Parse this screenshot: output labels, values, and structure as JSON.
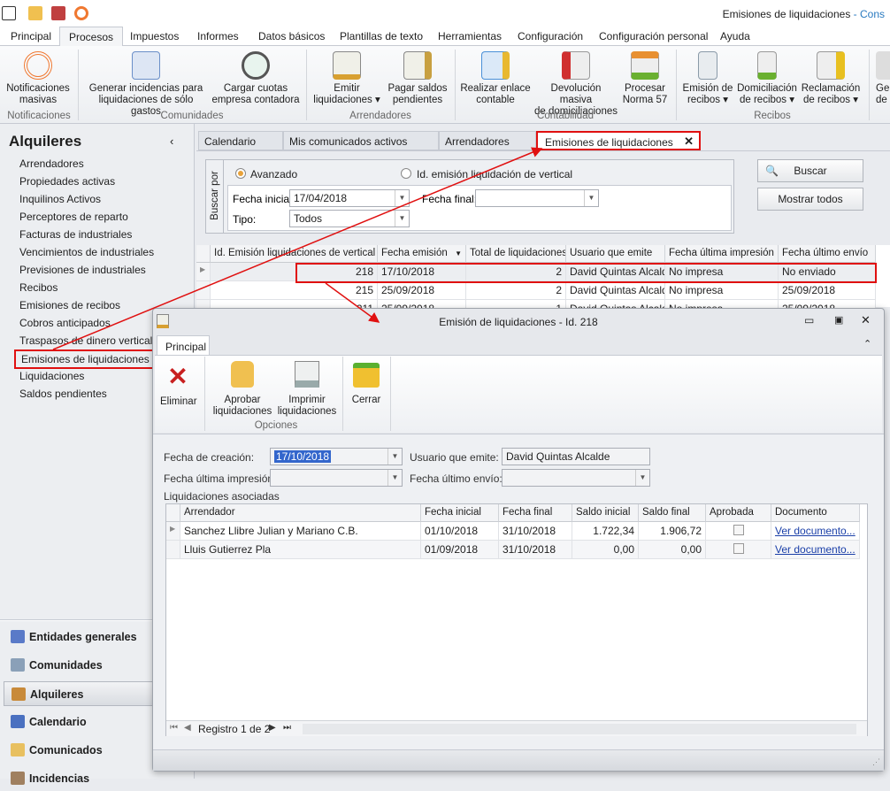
{
  "window": {
    "title": "Emisiones de liquidaciones",
    "title_suffix": "- Cons"
  },
  "menu_tabs": [
    "Principal",
    "Procesos",
    "Impuestos",
    "Informes",
    "Datos básicos",
    "Plantillas de texto",
    "Herramientas",
    "Configuración",
    "Configuración personal",
    "Ayuda"
  ],
  "ribbon": {
    "buttons": [
      {
        "l1": "Notificaciones",
        "l2": "masivas",
        "icon": "broadcast-icon",
        "color": "#f07830"
      },
      {
        "l1": "Generar incidencias para",
        "l2": "liquidaciones de sólo gastos",
        "icon": "checklist-icon",
        "color": "#6a8fc8"
      },
      {
        "l1": "Cargar cuotas",
        "l2": "empresa contadora",
        "icon": "gauge-icon",
        "color": "#3a9a6a"
      },
      {
        "l1": "Emitir",
        "l2": "liquidaciones ▾",
        "icon": "document-seal-icon",
        "color": "#d8a030"
      },
      {
        "l1": "Pagar saldos",
        "l2": "pendientes",
        "icon": "document-coins-icon",
        "color": "#c8a040"
      },
      {
        "l1": "Realizar enlace",
        "l2": "contable",
        "icon": "spreadsheet-coins-icon",
        "color": "#4a90d8"
      },
      {
        "l1": "Devolución masiva",
        "l2": "de domiciliaciones",
        "icon": "no-entry-icon",
        "color": "#d03030"
      },
      {
        "l1": "Procesar",
        "l2": "Norma 57",
        "icon": "up-down-arrows-icon",
        "color": "#e89030"
      },
      {
        "l1": "Emisión de",
        "l2": "recibos ▾",
        "icon": "receipt-icon",
        "color": "#8a9aa8"
      },
      {
        "l1": "Domiciliación",
        "l2": "de recibos ▾",
        "icon": "download-arrow-icon",
        "color": "#6ab030"
      },
      {
        "l1": "Reclamación",
        "l2": "de recibos ▾",
        "icon": "warning-icon",
        "color": "#e8c020"
      },
      {
        "l1": "Ge",
        "l2": "de",
        "icon": "generic-icon",
        "color": "#888888"
      }
    ],
    "groups": [
      "Notificaciones",
      "Comunidades",
      "Arrendadores",
      "Contabilidad",
      "Recibos"
    ]
  },
  "sidebar": {
    "title": "Alquileres",
    "items": [
      "Arrendadores",
      "Propiedades activas",
      "Inquilinos Activos",
      "Perceptores de reparto",
      "Facturas de industriales",
      "Vencimientos de industriales",
      "Previsiones de industriales",
      "Recibos",
      "Emisiones de recibos",
      "Cobros anticipados",
      "Traspasos de dinero vertical in",
      "Emisiones de liquidaciones",
      "Liquidaciones",
      "Saldos pendientes"
    ],
    "selected": "Emisiones de liquidaciones",
    "nav": [
      {
        "label": "Entidades generales",
        "color": "#5a7ac8"
      },
      {
        "label": "Comunidades",
        "color": "#8aa0b8"
      },
      {
        "label": "Alquileres",
        "color": "#c88a3a"
      },
      {
        "label": "Calendario",
        "color": "#4a70c0"
      },
      {
        "label": "Comunicados",
        "color": "#e8c060"
      },
      {
        "label": "Incidencias",
        "color": "#a08060"
      }
    ]
  },
  "doc_tabs": [
    "Calendario",
    "Mis comunicados activos",
    "Arrendadores",
    "Emisiones de liquidaciones"
  ],
  "search": {
    "group_label": "Buscar por",
    "radio_advanced": "Avanzado",
    "radio_id": "Id. emisión liquidación de vertical",
    "fecha_inicial_label": "Fecha inicial:",
    "fecha_inicial": "17/04/2018",
    "fecha_final_label": "Fecha final:",
    "fecha_final": "",
    "tipo_label": "Tipo:",
    "tipo": "Todos",
    "buscar": "Buscar",
    "mostrar_todos": "Mostrar todos"
  },
  "grid": {
    "columns": [
      "Id. Emisión liquidaciones de vertical",
      "Fecha emisión",
      "Total de liquidaciones",
      "Usuario que emite",
      "Fecha última impresión",
      "Fecha último envío"
    ],
    "rows": [
      [
        "218",
        "17/10/2018",
        "2",
        "David Quintas Alcalde",
        "No impresa",
        "No enviado"
      ],
      [
        "215",
        "25/09/2018",
        "2",
        "David Quintas Alcalde",
        "No impresa",
        "25/09/2018"
      ],
      [
        "211",
        "25/09/2018",
        "1",
        "David Quintas Alcalde",
        "No impresa",
        "25/09/2018"
      ]
    ]
  },
  "modal": {
    "title": "Emisión de liquidaciones - Id. 218",
    "tab": "Principal",
    "buttons": [
      "Eliminar",
      "Aprobar",
      "liquidaciones",
      "Imprimir",
      "liquidaciones",
      "Cerrar"
    ],
    "group": "Opciones",
    "fecha_creacion_label": "Fecha de creación:",
    "fecha_creacion": "17/10/2018",
    "usuario_label": "Usuario que emite:",
    "usuario": "David Quintas Alcalde",
    "fecha_impresion_label": "Fecha última impresión:",
    "fecha_envio_label": "Fecha último envío:",
    "liq_label": "Liquidaciones asociadas",
    "columns": [
      "Arrendador",
      "Fecha inicial",
      "Fecha final",
      "Saldo inicial",
      "Saldo final",
      "Aprobada",
      "Documento"
    ],
    "rows": [
      [
        "Sanchez Llibre Julian y Mariano C.B.",
        "01/10/2018",
        "31/10/2018",
        "1.722,34",
        "1.906,72",
        "",
        "Ver documento..."
      ],
      [
        "Lluis Gutierrez Pla",
        "01/09/2018",
        "31/10/2018",
        "0,00",
        "0,00",
        "",
        "Ver documento..."
      ]
    ],
    "record": "Registro 1 de 2"
  }
}
